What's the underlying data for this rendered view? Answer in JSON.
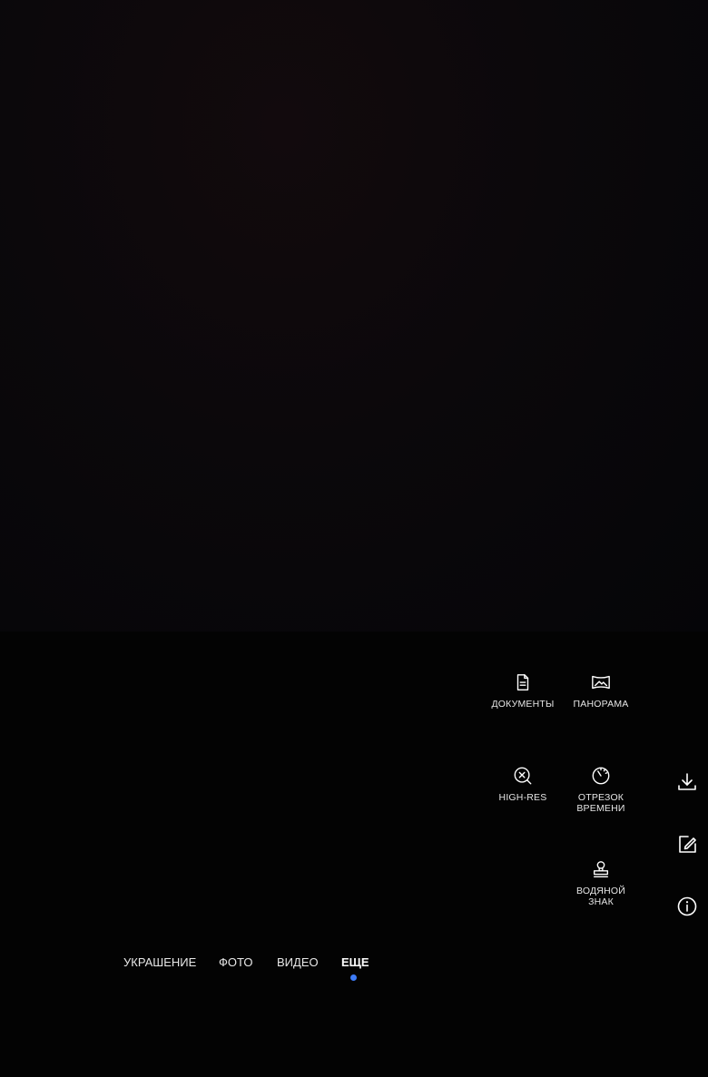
{
  "modes_grid": [
    {
      "id": "documents",
      "label": "ДОКУМЕНТЫ",
      "icon": "document-icon"
    },
    {
      "id": "panorama",
      "label": "ПАНОРАМА",
      "icon": "panorama-icon"
    },
    {
      "id": "high_res",
      "label": "HIGH-RES",
      "icon": "high-res-icon"
    },
    {
      "id": "time_lapse",
      "label": "ОТРЕЗОК\nВРЕМЕНИ",
      "icon": "timer-icon"
    },
    {
      "id": "watermark",
      "label": "ВОДЯНОЙ\nЗНАК",
      "icon": "stamp-icon"
    }
  ],
  "side_actions": [
    {
      "id": "download",
      "icon": "download-icon"
    },
    {
      "id": "edit",
      "icon": "edit-icon"
    },
    {
      "id": "info",
      "icon": "info-icon"
    }
  ],
  "mode_tabs": [
    {
      "label": "УКРАШЕНИЕ",
      "active": false
    },
    {
      "label": "ФОТО",
      "active": false
    },
    {
      "label": "ВИДЕО",
      "active": false
    },
    {
      "label": "ЕЩЕ",
      "active": true
    }
  ],
  "colors": {
    "accent": "#3d7bf7",
    "background": "#000000",
    "text": "#e8e8e8"
  }
}
